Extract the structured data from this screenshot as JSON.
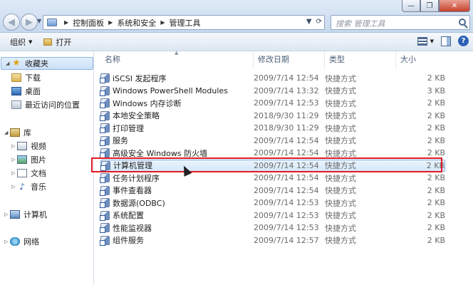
{
  "window": {
    "controls": {
      "minimize": "—",
      "maximize": "❐",
      "close": "✕"
    }
  },
  "address": {
    "crumbs": [
      "控制面板",
      "系统和安全",
      "管理工具"
    ]
  },
  "search": {
    "placeholder": "搜索 管理工具"
  },
  "toolbar": {
    "organize": "组织",
    "open": "打开"
  },
  "sidebar": {
    "favorites": "收藏夹",
    "fav_items": [
      "下载",
      "桌面",
      "最近访问的位置"
    ],
    "libraries": "库",
    "lib_items": [
      "视频",
      "图片",
      "文档",
      "音乐"
    ],
    "computer": "计算机",
    "network": "网络"
  },
  "columns": {
    "name": "名称",
    "date": "修改日期",
    "type": "类型",
    "size": "大小"
  },
  "files": [
    {
      "name": "iSCSI 发起程序",
      "date": "2009/7/14 12:54",
      "type": "快捷方式",
      "size": "2 KB"
    },
    {
      "name": "Windows PowerShell Modules",
      "date": "2009/7/14 13:32",
      "type": "快捷方式",
      "size": "3 KB"
    },
    {
      "name": "Windows 内存诊断",
      "date": "2009/7/14 12:53",
      "type": "快捷方式",
      "size": "2 KB"
    },
    {
      "name": "本地安全策略",
      "date": "2018/9/30 11:29",
      "type": "快捷方式",
      "size": "2 KB"
    },
    {
      "name": "打印管理",
      "date": "2018/9/30 11:29",
      "type": "快捷方式",
      "size": "2 KB"
    },
    {
      "name": "服务",
      "date": "2009/7/14 12:54",
      "type": "快捷方式",
      "size": "2 KB"
    },
    {
      "name": "高级安全 Windows 防火墙",
      "date": "2009/7/14 12:54",
      "type": "快捷方式",
      "size": "2 KB"
    },
    {
      "name": "计算机管理",
      "date": "2009/7/14 12:54",
      "type": "快捷方式",
      "size": "2 KB"
    },
    {
      "name": "任务计划程序",
      "date": "2009/7/14 12:54",
      "type": "快捷方式",
      "size": "2 KB"
    },
    {
      "name": "事件查看器",
      "date": "2009/7/14 12:54",
      "type": "快捷方式",
      "size": "2 KB"
    },
    {
      "name": "数据源(ODBC)",
      "date": "2009/7/14 12:53",
      "type": "快捷方式",
      "size": "2 KB"
    },
    {
      "name": "系统配置",
      "date": "2009/7/14 12:53",
      "type": "快捷方式",
      "size": "2 KB"
    },
    {
      "name": "性能监视器",
      "date": "2009/7/14 12:53",
      "type": "快捷方式",
      "size": "2 KB"
    },
    {
      "name": "组件服务",
      "date": "2009/7/14 12:57",
      "type": "快捷方式",
      "size": "2 KB"
    }
  ],
  "selected_index": 7,
  "colors": {
    "highlight": "#e31b23",
    "selection": "#d4e8fb"
  }
}
